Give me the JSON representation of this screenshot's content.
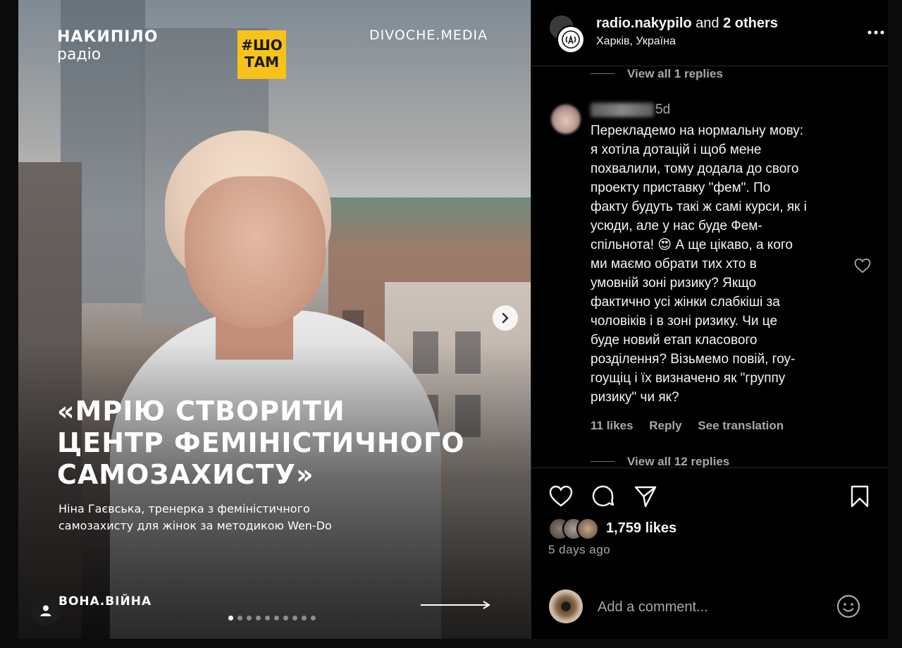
{
  "post": {
    "media": {
      "logo_left_line1": "НАКИПІЛО",
      "logo_left_line2": "радіо",
      "tag_line1": "#ШО",
      "tag_line2": "ТАМ",
      "logo_right": "DIVOCHE.MEDIA",
      "quote_lines": [
        "«МРІЮ СТВОРИТИ",
        "ЦЕНТР ФЕМІНІСТИЧНОГО",
        "САМОЗАХИСТУ»"
      ],
      "caption_lines": [
        "Ніна Гаєвська, тренерка з феміністичного",
        "самозахисту для жінок за методикою Wen-Do"
      ],
      "brand_bottom": "ВОНА.ВІЙНА",
      "carousel_count": 10,
      "carousel_active_index": 0
    },
    "header": {
      "account": "radio.nakypilo",
      "and_text": "and",
      "others": "2 others",
      "location": "Харків, Україна"
    },
    "thread": {
      "view_replies_top": "View all 1 replies",
      "comment": {
        "time": "5d",
        "text_lines": [
          "Перекладемо на нормальну мову:",
          "я хотіла дотацій і щоб мене",
          "похвалили, тому додала до свого",
          "проекту приставку \"фем\". По",
          "факту будуть такі ж самі курси, як і",
          "усюди, але у нас буде Фем-",
          "спільнота! 😍 А ще цікаво, а кого",
          "ми маємо обрати тих хто в",
          "умовній зоні ризику? Якщо",
          "фактично усі жінки слабкіші за",
          "чоловіків і в зоні ризику. Чи це",
          "буде новий етап класового",
          "розділення? Візьмемо повій, гоу-",
          "гоущіц і їх визначено як \"группу",
          "ризику\" чи як?"
        ],
        "likes": "11 likes",
        "reply": "Reply",
        "translate": "See translation"
      },
      "view_replies_bottom": "View all 12 replies"
    },
    "footer": {
      "likes": "1,759 likes",
      "ago": "5 days ago",
      "comment_placeholder": "Add a comment..."
    }
  },
  "icons": {
    "like": "heart-icon",
    "comment": "comment-bubble-icon",
    "share": "paper-plane-icon",
    "save": "bookmark-icon",
    "more": "more-horizontal-icon",
    "next": "chevron-right-icon",
    "user_tag": "person-icon",
    "emoji": "smiley-icon"
  },
  "colors": {
    "background": "#000000",
    "text_primary": "#f5f5f5",
    "text_secondary": "#a8a8a8",
    "divider": "#262626",
    "tag_yellow": "#f7c21a"
  }
}
